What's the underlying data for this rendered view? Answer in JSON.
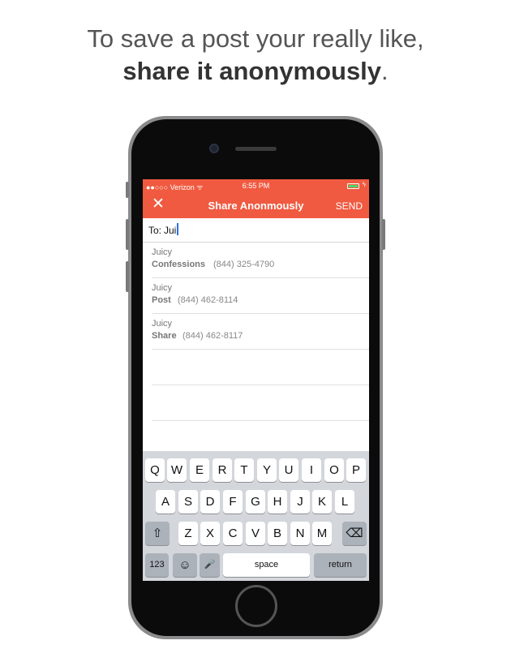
{
  "headline": {
    "line1": "To save a post your really like,",
    "line2_bold": "share it anonymously",
    "line2_suffix": "."
  },
  "status_bar": {
    "carrier": "●●○○○ Verizon ᯤ",
    "time": "6:55 PM",
    "battery_icon": "battery-icon",
    "charging_icon": "bolt-icon"
  },
  "nav": {
    "close_label": "✕",
    "title": "Share Anonmously",
    "send_label": "SEND"
  },
  "to_field": {
    "label": "To:",
    "value": "Jui"
  },
  "suggestions": [
    {
      "name": "Juicy",
      "type": "Confessions",
      "phone": "(844) 325-4790"
    },
    {
      "name": "Juicy",
      "type": "Post",
      "phone": "(844) 462-8114"
    },
    {
      "name": "Juicy",
      "type": "Share",
      "phone": "(844) 462-8117"
    }
  ],
  "keyboard": {
    "row1": [
      "Q",
      "W",
      "E",
      "R",
      "T",
      "Y",
      "U",
      "I",
      "O",
      "P"
    ],
    "row2": [
      "A",
      "S",
      "D",
      "F",
      "G",
      "H",
      "J",
      "K",
      "L"
    ],
    "row3": [
      "Z",
      "X",
      "C",
      "V",
      "B",
      "N",
      "M"
    ],
    "shift_icon": "⇧",
    "delete_icon": "⌫",
    "numbers_label": "123",
    "emoji_icon": "☺",
    "mic_icon": "🎤",
    "space_label": "space",
    "return_label": "return"
  },
  "colors": {
    "accent": "#f05a40",
    "keyboard_bg": "#d3d6db"
  }
}
